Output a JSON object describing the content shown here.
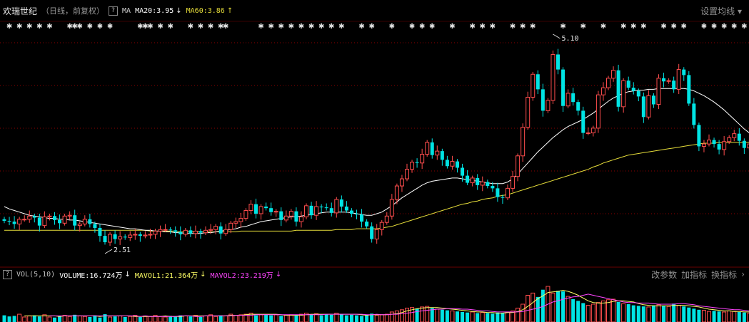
{
  "header": {
    "stock_name": "欢瑞世纪",
    "mode": "（日线，前复权）",
    "help": "?",
    "indicator": "MA",
    "ma20_label": "MA20:3.95",
    "ma20_arrow": "↓",
    "ma60_label": "MA60:3.86",
    "ma60_arrow": "↑",
    "settings_label": "设置均线"
  },
  "volume": {
    "vol_label": "VOL(5,10)",
    "volume_label": "VOLUME:16.724万",
    "volume_arrow": "↓",
    "mavol1_label": "MAVOL1:21.364万",
    "mavol1_arrow": "↓",
    "mavol2_label": "MAVOL2:23.219万",
    "mavol2_arrow": "↓",
    "buttons": [
      "改参数",
      "加指标",
      "换指标"
    ]
  },
  "annotations": {
    "high": "5.10",
    "low": "2.51"
  },
  "colors": {
    "up": "#ff4d4d",
    "down": "#00e4e4",
    "ma20": "#ffffff",
    "ma60": "#e6dd3a",
    "mavol1": "#ffff66",
    "mavol2": "#ff44ff",
    "grid": "#8b0000"
  },
  "chart_data": {
    "type": "candlestick",
    "price_high": 5.1,
    "price_low": 2.51,
    "ohlc_open": [
      2.89,
      2.87,
      2.86,
      2.83,
      2.89,
      2.89,
      2.93,
      2.91,
      2.81,
      2.92,
      2.93,
      2.88,
      2.84,
      2.93,
      2.94,
      2.81,
      2.83,
      2.89,
      2.83,
      2.78,
      2.68,
      2.6,
      2.7,
      2.64,
      2.67,
      2.66,
      2.69,
      2.7,
      2.68,
      2.69,
      2.7,
      2.74,
      2.76,
      2.76,
      2.75,
      2.73,
      2.7,
      2.75,
      2.71,
      2.74,
      2.72,
      2.75,
      2.76,
      2.8,
      2.71,
      2.76,
      2.84,
      2.86,
      2.9,
      3.0,
      3.08,
      2.96,
      3.05,
      3.03,
      2.98,
      2.99,
      2.88,
      2.93,
      2.99,
      2.86,
      2.92,
      3.06,
      2.94,
      3.05,
      3.04,
      3.03,
      2.97,
      3.14,
      3.05,
      3.0,
      2.96,
      2.95,
      2.86,
      2.8,
      2.64,
      2.76,
      2.85,
      2.93,
      3.14,
      3.31,
      3.4,
      3.52,
      3.61,
      3.6,
      3.71,
      3.86,
      3.7,
      3.75,
      3.64,
      3.56,
      3.62,
      3.54,
      3.44,
      3.35,
      3.41,
      3.32,
      3.36,
      3.31,
      3.28,
      3.17,
      3.16,
      3.28,
      3.43,
      3.69,
      4.05,
      4.43,
      4.72,
      4.53,
      4.26,
      4.39,
      4.97,
      4.78,
      4.32,
      4.48,
      4.37,
      4.26,
      3.98,
      3.98,
      4.04,
      4.46,
      4.55,
      4.67,
      4.77,
      4.31,
      4.64,
      4.55,
      4.51,
      4.44,
      4.18,
      4.45,
      4.34,
      4.67,
      4.63,
      4.64,
      4.53,
      4.78,
      4.71,
      4.35,
      4.08,
      3.81,
      3.84,
      3.89,
      3.84,
      3.77,
      3.87,
      3.92,
      3.97,
      3.88,
      3.79
    ],
    "ohlc_close": [
      2.87,
      2.86,
      2.83,
      2.89,
      2.89,
      2.93,
      2.91,
      2.81,
      2.92,
      2.93,
      2.88,
      2.84,
      2.93,
      2.94,
      2.81,
      2.83,
      2.89,
      2.83,
      2.78,
      2.68,
      2.6,
      2.7,
      2.64,
      2.67,
      2.66,
      2.69,
      2.7,
      2.68,
      2.69,
      2.7,
      2.74,
      2.76,
      2.76,
      2.75,
      2.73,
      2.7,
      2.75,
      2.71,
      2.74,
      2.72,
      2.75,
      2.76,
      2.8,
      2.71,
      2.76,
      2.84,
      2.86,
      2.9,
      3.0,
      3.08,
      2.96,
      3.05,
      3.03,
      2.98,
      2.99,
      2.88,
      2.93,
      2.99,
      2.86,
      2.92,
      3.06,
      2.94,
      3.05,
      3.04,
      3.03,
      2.97,
      3.14,
      3.05,
      3.0,
      2.96,
      2.95,
      2.86,
      2.8,
      2.64,
      2.76,
      2.85,
      2.93,
      3.14,
      3.31,
      3.4,
      3.52,
      3.61,
      3.6,
      3.71,
      3.86,
      3.7,
      3.75,
      3.64,
      3.56,
      3.62,
      3.54,
      3.44,
      3.35,
      3.41,
      3.32,
      3.36,
      3.31,
      3.28,
      3.17,
      3.16,
      3.28,
      3.43,
      3.69,
      4.05,
      4.43,
      4.72,
      4.53,
      4.26,
      4.39,
      4.97,
      4.78,
      4.32,
      4.48,
      4.37,
      4.26,
      3.98,
      3.98,
      4.04,
      4.46,
      4.55,
      4.67,
      4.77,
      4.31,
      4.64,
      4.55,
      4.51,
      4.44,
      4.18,
      4.45,
      4.34,
      4.67,
      4.63,
      4.64,
      4.53,
      4.78,
      4.71,
      4.35,
      4.08,
      3.81,
      3.84,
      3.89,
      3.84,
      3.77,
      3.87,
      3.92,
      3.97,
      3.88,
      3.79,
      3.84
    ],
    "ma20": [
      3.05,
      3.02,
      3.0,
      2.98,
      2.96,
      2.94,
      2.93,
      2.92,
      2.91,
      2.9,
      2.9,
      2.89,
      2.89,
      2.88,
      2.88,
      2.87,
      2.86,
      2.85,
      2.84,
      2.83,
      2.82,
      2.81,
      2.8,
      2.79,
      2.78,
      2.77,
      2.77,
      2.76,
      2.75,
      2.75,
      2.74,
      2.74,
      2.73,
      2.73,
      2.72,
      2.72,
      2.71,
      2.71,
      2.71,
      2.71,
      2.72,
      2.72,
      2.73,
      2.74,
      2.75,
      2.76,
      2.77,
      2.79,
      2.8,
      2.82,
      2.84,
      2.86,
      2.87,
      2.88,
      2.89,
      2.9,
      2.91,
      2.92,
      2.92,
      2.93,
      2.94,
      2.95,
      2.96,
      2.97,
      2.98,
      2.98,
      2.98,
      2.98,
      2.98,
      2.97,
      2.96,
      2.95,
      2.94,
      2.94,
      2.96,
      2.98,
      3.02,
      3.06,
      3.11,
      3.16,
      3.2,
      3.24,
      3.28,
      3.32,
      3.35,
      3.37,
      3.38,
      3.39,
      3.4,
      3.41,
      3.41,
      3.4,
      3.39,
      3.38,
      3.37,
      3.36,
      3.35,
      3.34,
      3.34,
      3.34,
      3.36,
      3.4,
      3.46,
      3.53,
      3.6,
      3.67,
      3.74,
      3.8,
      3.86,
      3.92,
      3.97,
      4.02,
      4.06,
      4.09,
      4.12,
      4.15,
      4.19,
      4.23,
      4.28,
      4.33,
      4.38,
      4.42,
      4.45,
      4.48,
      4.5,
      4.51,
      4.52,
      4.52,
      4.53,
      4.53,
      4.54,
      4.54,
      4.54,
      4.54,
      4.54,
      4.54,
      4.53,
      4.51,
      4.48,
      4.45,
      4.41,
      4.37,
      4.32,
      4.27,
      4.21,
      4.15,
      4.09,
      4.03,
      3.98
    ],
    "ma60": [
      2.75,
      2.75,
      2.75,
      2.75,
      2.75,
      2.75,
      2.75,
      2.75,
      2.75,
      2.75,
      2.75,
      2.75,
      2.75,
      2.75,
      2.75,
      2.75,
      2.75,
      2.75,
      2.75,
      2.75,
      2.75,
      2.75,
      2.75,
      2.75,
      2.75,
      2.75,
      2.75,
      2.75,
      2.75,
      2.74,
      2.74,
      2.74,
      2.74,
      2.74,
      2.74,
      2.73,
      2.73,
      2.73,
      2.73,
      2.73,
      2.73,
      2.73,
      2.73,
      2.73,
      2.73,
      2.73,
      2.73,
      2.74,
      2.74,
      2.74,
      2.74,
      2.74,
      2.74,
      2.74,
      2.74,
      2.74,
      2.74,
      2.74,
      2.75,
      2.75,
      2.75,
      2.75,
      2.75,
      2.75,
      2.75,
      2.75,
      2.76,
      2.76,
      2.76,
      2.76,
      2.77,
      2.77,
      2.77,
      2.77,
      2.77,
      2.78,
      2.79,
      2.8,
      2.82,
      2.84,
      2.86,
      2.88,
      2.9,
      2.92,
      2.94,
      2.96,
      2.98,
      3.0,
      3.02,
      3.04,
      3.06,
      3.08,
      3.09,
      3.11,
      3.12,
      3.14,
      3.15,
      3.16,
      3.18,
      3.19,
      3.2,
      3.22,
      3.24,
      3.26,
      3.28,
      3.3,
      3.32,
      3.34,
      3.36,
      3.38,
      3.4,
      3.42,
      3.44,
      3.46,
      3.48,
      3.5,
      3.52,
      3.55,
      3.57,
      3.6,
      3.62,
      3.64,
      3.66,
      3.68,
      3.7,
      3.71,
      3.72,
      3.73,
      3.74,
      3.75,
      3.76,
      3.77,
      3.78,
      3.79,
      3.8,
      3.81,
      3.82,
      3.83,
      3.84,
      3.85,
      3.85,
      3.85,
      3.86,
      3.86,
      3.86,
      3.86,
      3.86,
      3.86,
      3.86,
      3.86
    ],
    "volume": [
      12,
      10,
      11,
      14,
      9,
      11,
      12,
      10,
      13,
      9,
      8,
      11,
      12,
      10,
      13,
      11,
      10,
      9,
      12,
      8,
      14,
      9,
      10,
      11,
      9,
      10,
      12,
      9,
      11,
      10,
      12,
      10,
      9,
      11,
      10,
      12,
      11,
      10,
      12,
      9,
      11,
      13,
      10,
      12,
      11,
      14,
      12,
      13,
      14,
      16,
      12,
      13,
      14,
      12,
      13,
      11,
      12,
      13,
      12,
      14,
      16,
      13,
      15,
      12,
      14,
      13,
      16,
      14,
      12,
      13,
      12,
      11,
      13,
      15,
      12,
      13,
      14,
      18,
      20,
      22,
      25,
      26,
      24,
      27,
      28,
      25,
      23,
      22,
      21,
      20,
      19,
      18,
      17,
      18,
      16,
      17,
      16,
      15,
      17,
      16,
      18,
      20,
      25,
      32,
      48,
      52,
      45,
      58,
      64,
      52,
      56,
      55,
      46,
      41,
      38,
      34,
      30,
      32,
      35,
      38,
      40,
      41,
      36,
      33,
      32,
      30,
      29,
      28,
      27,
      30,
      31,
      29,
      28,
      33,
      30,
      28,
      26,
      24,
      22,
      21,
      19,
      20,
      19,
      18,
      20,
      19,
      18,
      17,
      16
    ],
    "mavol1": [
      null,
      null,
      null,
      null,
      11,
      11,
      11,
      11,
      11,
      11,
      11,
      10,
      11,
      11,
      11,
      11,
      11,
      11,
      11,
      10,
      11,
      11,
      11,
      11,
      11,
      11,
      10,
      10,
      10,
      10,
      10,
      10,
      11,
      10,
      10,
      10,
      11,
      11,
      11,
      11,
      11,
      11,
      11,
      11,
      11,
      12,
      12,
      12,
      13,
      14,
      14,
      14,
      14,
      14,
      14,
      13,
      12,
      12,
      12,
      12,
      13,
      14,
      14,
      14,
      14,
      14,
      14,
      14,
      14,
      14,
      14,
      13,
      12,
      13,
      13,
      13,
      13,
      14,
      15,
      17,
      20,
      22,
      24,
      25,
      26,
      26,
      26,
      25,
      24,
      23,
      22,
      21,
      20,
      19,
      18,
      18,
      17,
      17,
      16,
      16,
      17,
      17,
      19,
      22,
      28,
      35,
      42,
      47,
      53,
      54,
      55,
      57,
      55,
      52,
      48,
      43,
      38,
      35,
      34,
      34,
      35,
      37,
      38,
      38,
      37,
      36,
      33,
      31,
      30,
      29,
      29,
      29,
      29,
      30,
      30,
      30,
      29,
      28,
      27,
      25,
      23,
      22,
      21,
      20,
      20,
      19,
      19,
      18,
      18
    ],
    "mavol2": [
      null,
      null,
      null,
      null,
      null,
      null,
      null,
      null,
      null,
      11,
      11,
      11,
      11,
      11,
      11,
      11,
      11,
      11,
      11,
      11,
      11,
      11,
      11,
      11,
      11,
      11,
      11,
      10,
      11,
      10,
      10,
      10,
      10,
      10,
      10,
      11,
      11,
      11,
      10,
      10,
      11,
      11,
      11,
      11,
      11,
      11,
      12,
      12,
      12,
      12,
      13,
      13,
      13,
      13,
      13,
      13,
      13,
      13,
      13,
      13,
      13,
      13,
      13,
      13,
      14,
      14,
      14,
      14,
      14,
      14,
      14,
      14,
      13,
      13,
      14,
      13,
      13,
      14,
      14,
      15,
      16,
      17,
      19,
      20,
      21,
      22,
      23,
      23,
      24,
      24,
      24,
      23,
      23,
      22,
      21,
      20,
      20,
      19,
      18,
      18,
      18,
      18,
      18,
      19,
      21,
      23,
      25,
      28,
      32,
      36,
      38,
      41,
      43,
      45,
      46,
      48,
      50,
      48,
      46,
      44,
      42,
      40,
      38,
      36,
      35,
      35,
      34,
      34,
      34,
      33,
      32,
      32,
      32,
      32,
      33,
      33,
      32,
      31,
      29,
      28,
      27,
      26,
      25,
      24,
      23,
      22,
      22,
      21,
      20
    ]
  },
  "marker_columns": [
    1,
    3,
    5,
    7,
    9,
    13,
    14,
    15,
    17,
    19,
    21,
    27,
    28,
    29,
    31,
    33,
    37,
    39,
    41,
    43,
    44,
    51,
    53,
    55,
    57,
    59,
    61,
    63,
    65,
    67,
    71,
    73,
    77,
    81,
    83,
    85,
    89,
    93,
    95,
    97,
    101,
    103,
    105,
    111,
    115,
    119,
    123,
    125,
    127,
    131,
    133,
    135,
    139,
    141,
    143,
    145,
    147
  ]
}
